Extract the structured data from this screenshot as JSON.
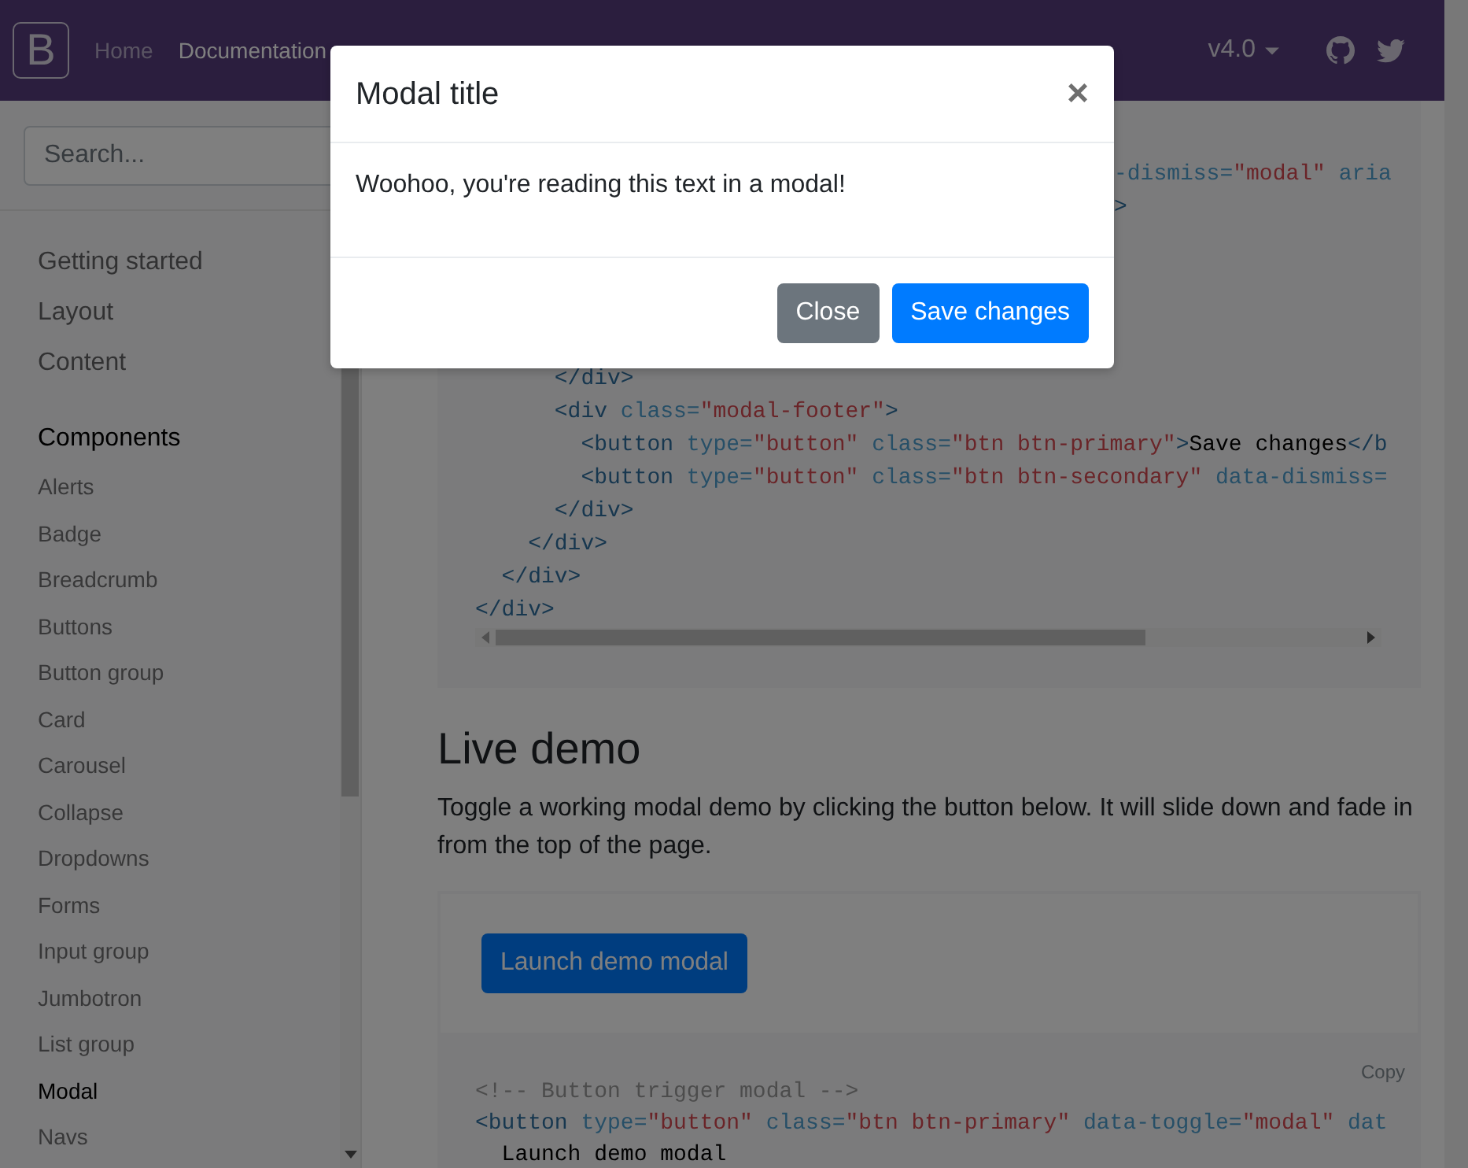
{
  "navbar": {
    "logo": "B",
    "links": [
      {
        "label": "Home",
        "selected": false
      },
      {
        "label": "Documentation",
        "selected": true
      }
    ],
    "version": "v4.0"
  },
  "sidebar": {
    "search": {
      "placeholder": "Search..."
    },
    "sections": [
      {
        "label": "Getting started",
        "selected": false
      },
      {
        "label": "Layout",
        "selected": false
      },
      {
        "label": "Content",
        "selected": false
      },
      {
        "label": "Components",
        "selected": true,
        "items": [
          {
            "label": "Alerts",
            "selected": false
          },
          {
            "label": "Badge",
            "selected": false
          },
          {
            "label": "Breadcrumb",
            "selected": false
          },
          {
            "label": "Buttons",
            "selected": false
          },
          {
            "label": "Button group",
            "selected": false
          },
          {
            "label": "Card",
            "selected": false
          },
          {
            "label": "Carousel",
            "selected": false
          },
          {
            "label": "Collapse",
            "selected": false
          },
          {
            "label": "Dropdowns",
            "selected": false
          },
          {
            "label": "Forms",
            "selected": false
          },
          {
            "label": "Input group",
            "selected": false
          },
          {
            "label": "Jumbotron",
            "selected": false
          },
          {
            "label": "List group",
            "selected": false
          },
          {
            "label": "Modal",
            "selected": true
          },
          {
            "label": "Navs",
            "selected": false
          }
        ]
      }
    ]
  },
  "code_example": {
    "top_lines": [
      [
        {
          "kind": "attr",
          "text": "-dismiss="
        },
        {
          "kind": "str",
          "text": "\"modal\""
        },
        {
          "kind": "attr",
          "text": " aria"
        }
      ],
      [
        {
          "kind": "tag",
          "text": ">"
        }
      ]
    ],
    "lines": [
      [
        {
          "kind": "tag",
          "text": "      </div>"
        }
      ],
      [
        {
          "kind": "tag",
          "text": "      <div"
        },
        {
          "kind": "attr",
          "text": " class="
        },
        {
          "kind": "str",
          "text": "\"modal-footer\""
        },
        {
          "kind": "tag",
          "text": ">"
        }
      ],
      [
        {
          "kind": "tag",
          "text": "        <button"
        },
        {
          "kind": "attr",
          "text": " type="
        },
        {
          "kind": "str",
          "text": "\"button\""
        },
        {
          "kind": "attr",
          "text": " class="
        },
        {
          "kind": "str",
          "text": "\"btn btn-primary\""
        },
        {
          "kind": "tag",
          "text": ">"
        },
        {
          "kind": "text",
          "text": "Save changes"
        },
        {
          "kind": "tag",
          "text": "</b"
        }
      ],
      [
        {
          "kind": "tag",
          "text": "        <button"
        },
        {
          "kind": "attr",
          "text": " type="
        },
        {
          "kind": "str",
          "text": "\"button\""
        },
        {
          "kind": "attr",
          "text": " class="
        },
        {
          "kind": "str",
          "text": "\"btn btn-secondary\""
        },
        {
          "kind": "attr",
          "text": " data-dismiss="
        }
      ],
      [
        {
          "kind": "tag",
          "text": "      </div>"
        }
      ],
      [
        {
          "kind": "tag",
          "text": "    </div>"
        }
      ],
      [
        {
          "kind": "tag",
          "text": "  </div>"
        }
      ],
      [
        {
          "kind": "tag",
          "text": "</div>"
        }
      ]
    ]
  },
  "live_demo": {
    "heading": "Live demo",
    "description": "Toggle a working modal demo by clicking the button below. It will slide down and fade in from the top of the page.",
    "button": "Launch demo modal",
    "copy": "Copy",
    "code_lines": [
      [
        {
          "kind": "comment",
          "text": "<!-- Button trigger modal -->"
        }
      ],
      [
        {
          "kind": "tag",
          "text": "<button"
        },
        {
          "kind": "attr",
          "text": " type="
        },
        {
          "kind": "str",
          "text": "\"button\""
        },
        {
          "kind": "attr",
          "text": " class="
        },
        {
          "kind": "str",
          "text": "\"btn btn-primary\""
        },
        {
          "kind": "attr",
          "text": " data-toggle="
        },
        {
          "kind": "str",
          "text": "\"modal\""
        },
        {
          "kind": "attr",
          "text": " dat"
        }
      ],
      [
        {
          "kind": "text",
          "text": "  Launch demo modal"
        }
      ]
    ]
  },
  "modal": {
    "title": "Modal title",
    "close": "×",
    "body": "Woohoo, you're reading this text in a modal!",
    "buttons": [
      {
        "label": "Close",
        "kind": "secondary"
      },
      {
        "label": "Save changes",
        "kind": "primary"
      }
    ]
  }
}
